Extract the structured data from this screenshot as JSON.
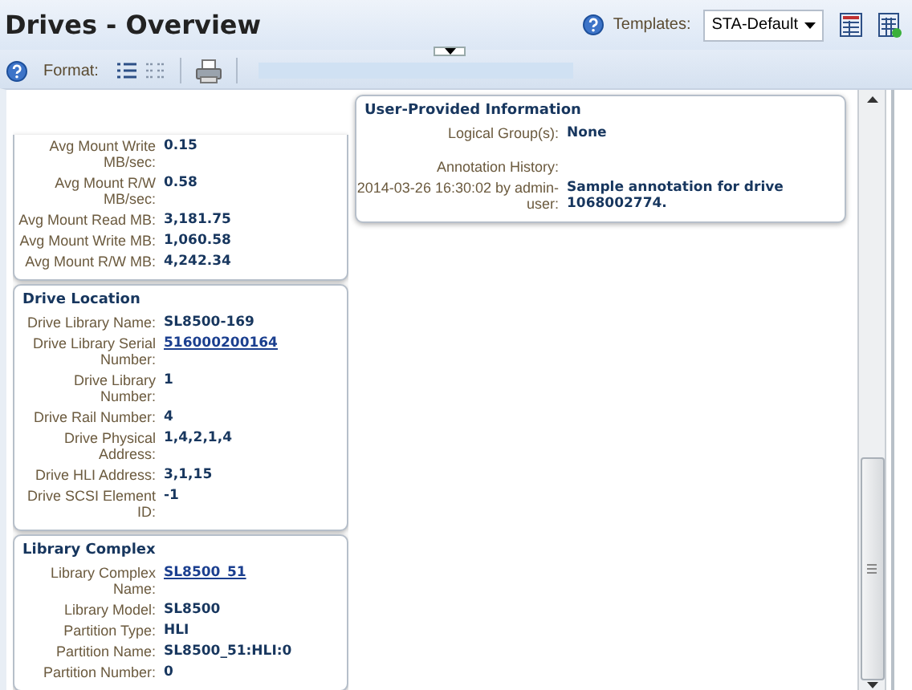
{
  "header": {
    "title": "Drives - Overview",
    "templates_label": "Templates:",
    "template_value": "STA-Default"
  },
  "toolbar": {
    "format_label": "Format:"
  },
  "left_panels": [
    {
      "cut_top": true,
      "rows": [
        {
          "label": "Avg Mount Write MB/sec:",
          "value": "0.15",
          "link": false
        },
        {
          "label": "Avg Mount R/W MB/sec:",
          "value": "0.58",
          "link": false
        },
        {
          "label": "Avg Mount Read MB:",
          "value": "3,181.75",
          "link": false
        },
        {
          "label": "Avg Mount Write MB:",
          "value": "1,060.58",
          "link": false
        },
        {
          "label": "Avg Mount R/W MB:",
          "value": "4,242.34",
          "link": false
        }
      ]
    },
    {
      "title": "Drive Location",
      "cut_top": false,
      "rows": [
        {
          "label": "Drive Library Name:",
          "value": "SL8500-169",
          "link": false
        },
        {
          "label": "Drive Library Serial Number:",
          "value": "516000200164",
          "link": true
        },
        {
          "label": "Drive Library Number:",
          "value": "1",
          "link": false
        },
        {
          "label": "Drive Rail Number:",
          "value": "4",
          "link": false
        },
        {
          "label": "Drive Physical Address:",
          "value": "1,4,2,1,4",
          "link": false
        },
        {
          "label": "Drive HLI Address:",
          "value": "3,1,15",
          "link": false
        },
        {
          "label": "Drive SCSI Element ID:",
          "value": "-1",
          "link": false
        }
      ]
    },
    {
      "title": "Library Complex",
      "cut_top": false,
      "rows": [
        {
          "label": "Library Complex Name:",
          "value": "SL8500_51",
          "link": true
        },
        {
          "label": "Library Model:",
          "value": "SL8500",
          "link": false
        },
        {
          "label": "Partition Type:",
          "value": "HLI",
          "link": false
        },
        {
          "label": "Partition Name:",
          "value": "SL8500_51:HLI:0",
          "link": false
        },
        {
          "label": "Partition Number:",
          "value": "0",
          "link": false
        }
      ]
    }
  ],
  "right_panels": [
    {
      "title": "User-Provided Information",
      "cut_top": false,
      "rows": [
        {
          "label": "Logical Group(s):",
          "value": "None",
          "link": false
        },
        {
          "label": "Annotation History:"
        },
        {
          "label": "2014-03-26 16:30:02 by admin-user:",
          "value": "Sample annotation for drive 1068002774.",
          "link": false
        }
      ]
    }
  ]
}
